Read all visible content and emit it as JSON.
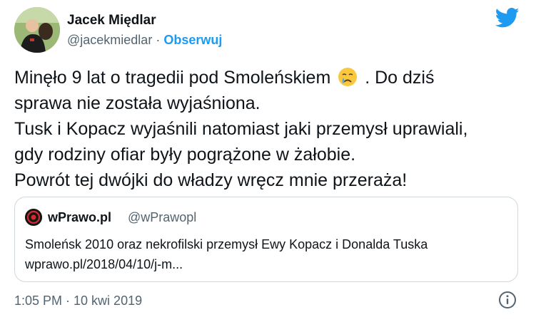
{
  "author": {
    "name": "Jacek Międlar",
    "handle": "@jacekmiedlar",
    "separator": "·",
    "follow_label": "Obserwuj",
    "avatar_icon": "profile-photo"
  },
  "brand_icon": "twitter-bird-icon",
  "tweet": {
    "line1_a": "Minęło 9 lat o tragedii pod Smoleńskiem",
    "emoji": "crying-face-emoji",
    "line1_b": ". Do dziś",
    "line2": "sprawa nie została wyjaśniona.",
    "line3": "Tusk i Kopacz wyjaśnili natomiast jaki przemysł uprawiali,",
    "line4": "gdy rodziny ofiar były pogrążone w żałobie.",
    "line5": "Powrót tej dwójki do władzy wręcz mnie przeraża!"
  },
  "quoted": {
    "name": "wPrawo.pl",
    "handle": "@wPrawopl",
    "text_line1": "Smoleńsk 2010 oraz nekrofilski przemysł Ewy Kopacz i Donalda Tuska",
    "text_line2": "wprawo.pl/2018/04/10/j-m..."
  },
  "timestamp": "1:05 PM · 10 kwi 2019",
  "colors": {
    "accent": "#1d9bf0",
    "text": "#0f1419",
    "secondary": "#536471",
    "border": "#cfd9de"
  }
}
